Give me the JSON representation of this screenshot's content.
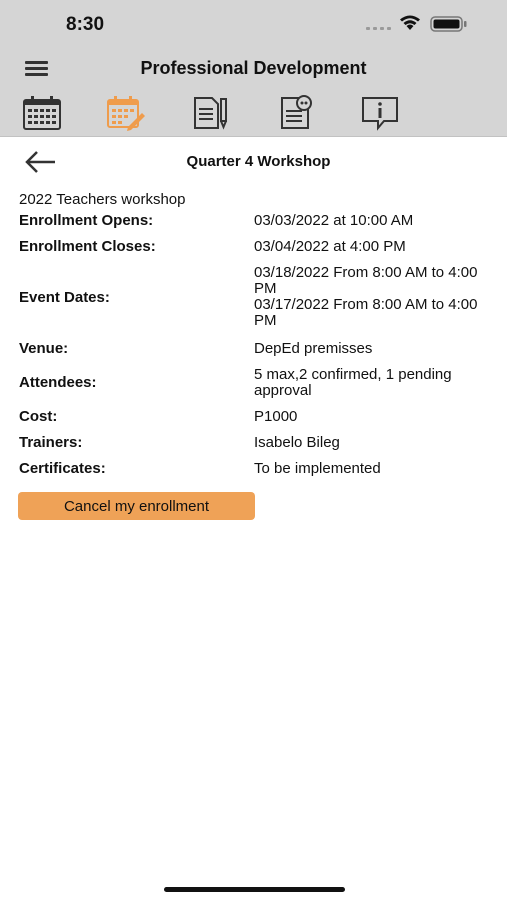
{
  "status_bar": {
    "time": "8:30"
  },
  "nav": {
    "title": "Professional Development"
  },
  "toolbar": {
    "active_color": "#ef9c4c",
    "inactive_color": "#333333"
  },
  "page": {
    "title": "Quarter 4 Workshop",
    "subtitle": "2022 Teachers workshop"
  },
  "details": {
    "enrollment_opens": {
      "label": "Enrollment Opens:",
      "value": "03/03/2022 at 10:00 AM"
    },
    "enrollment_closes": {
      "label": "Enrollment Closes:",
      "value": "03/04/2022 at 4:00 PM"
    },
    "event_dates": {
      "label": "Event Dates:",
      "value": "03/18/2022 From 8:00 AM to 4:00 PM\n03/17/2022 From 8:00 AM to 4:00 PM"
    },
    "venue": {
      "label": "Venue:",
      "value": "DepEd premisses"
    },
    "attendees": {
      "label": "Attendees:",
      "value": "5 max,2 confirmed, 1 pending approval"
    },
    "cost": {
      "label": "Cost:",
      "value": "P1000"
    },
    "trainers": {
      "label": "Trainers:",
      "value": "Isabelo Bileg"
    },
    "certificates": {
      "label": "Certificates:",
      "value": "To be implemented"
    }
  },
  "actions": {
    "cancel_label": "Cancel my enrollment",
    "cancel_color": "#efa257"
  }
}
